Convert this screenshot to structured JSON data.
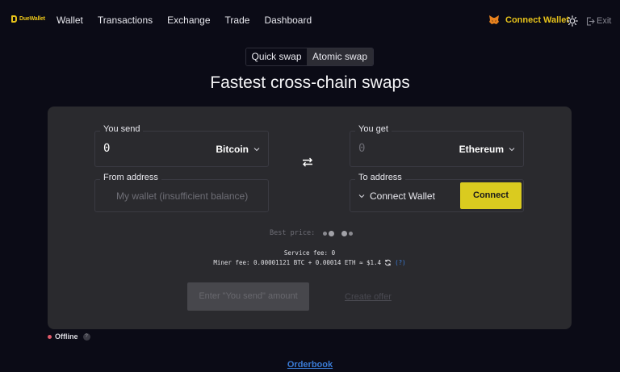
{
  "nav": {
    "logo_text": "DueWallet",
    "links": [
      "Wallet",
      "Transactions",
      "Exchange",
      "Trade",
      "Dashboard"
    ],
    "connect_wallet": "Connect Wallet",
    "exit": "Exit",
    "icons": {
      "wallet": "fox-icon",
      "theme": "sun-icon",
      "exit": "exit-icon"
    }
  },
  "tabs": [
    "Quick swap",
    "Atomic swap"
  ],
  "headline": "Fastest cross-chain swaps",
  "swap": {
    "send_label": "You send",
    "send_amount": "0",
    "send_currency": "Bitcoin",
    "get_label": "You get",
    "get_amount": "0",
    "get_currency": "Ethereum",
    "from_label": "From address",
    "from_placeholder": "My wallet (insufficient balance)",
    "to_label": "To address",
    "to_value": "Connect Wallet",
    "connect_button": "Connect",
    "best_price_label": "Best price:",
    "service_fee": "Service fee: 0",
    "miner_fee": "Miner fee: 0.00001121 BTC + 0.00014 ETH ≈ $1.4",
    "miner_fee_help": "(?)",
    "enter_button": "Enter \"You send\" amount",
    "create_offer": "Create offer"
  },
  "status": {
    "label": "Offline",
    "help": "?"
  },
  "orderbook": "Orderbook",
  "colors": {
    "background": "#0b0b16",
    "panel": "#2a2a2e",
    "accent": "#dacb1f",
    "link": "#3a7bd5",
    "offline": "#e05a6a"
  }
}
